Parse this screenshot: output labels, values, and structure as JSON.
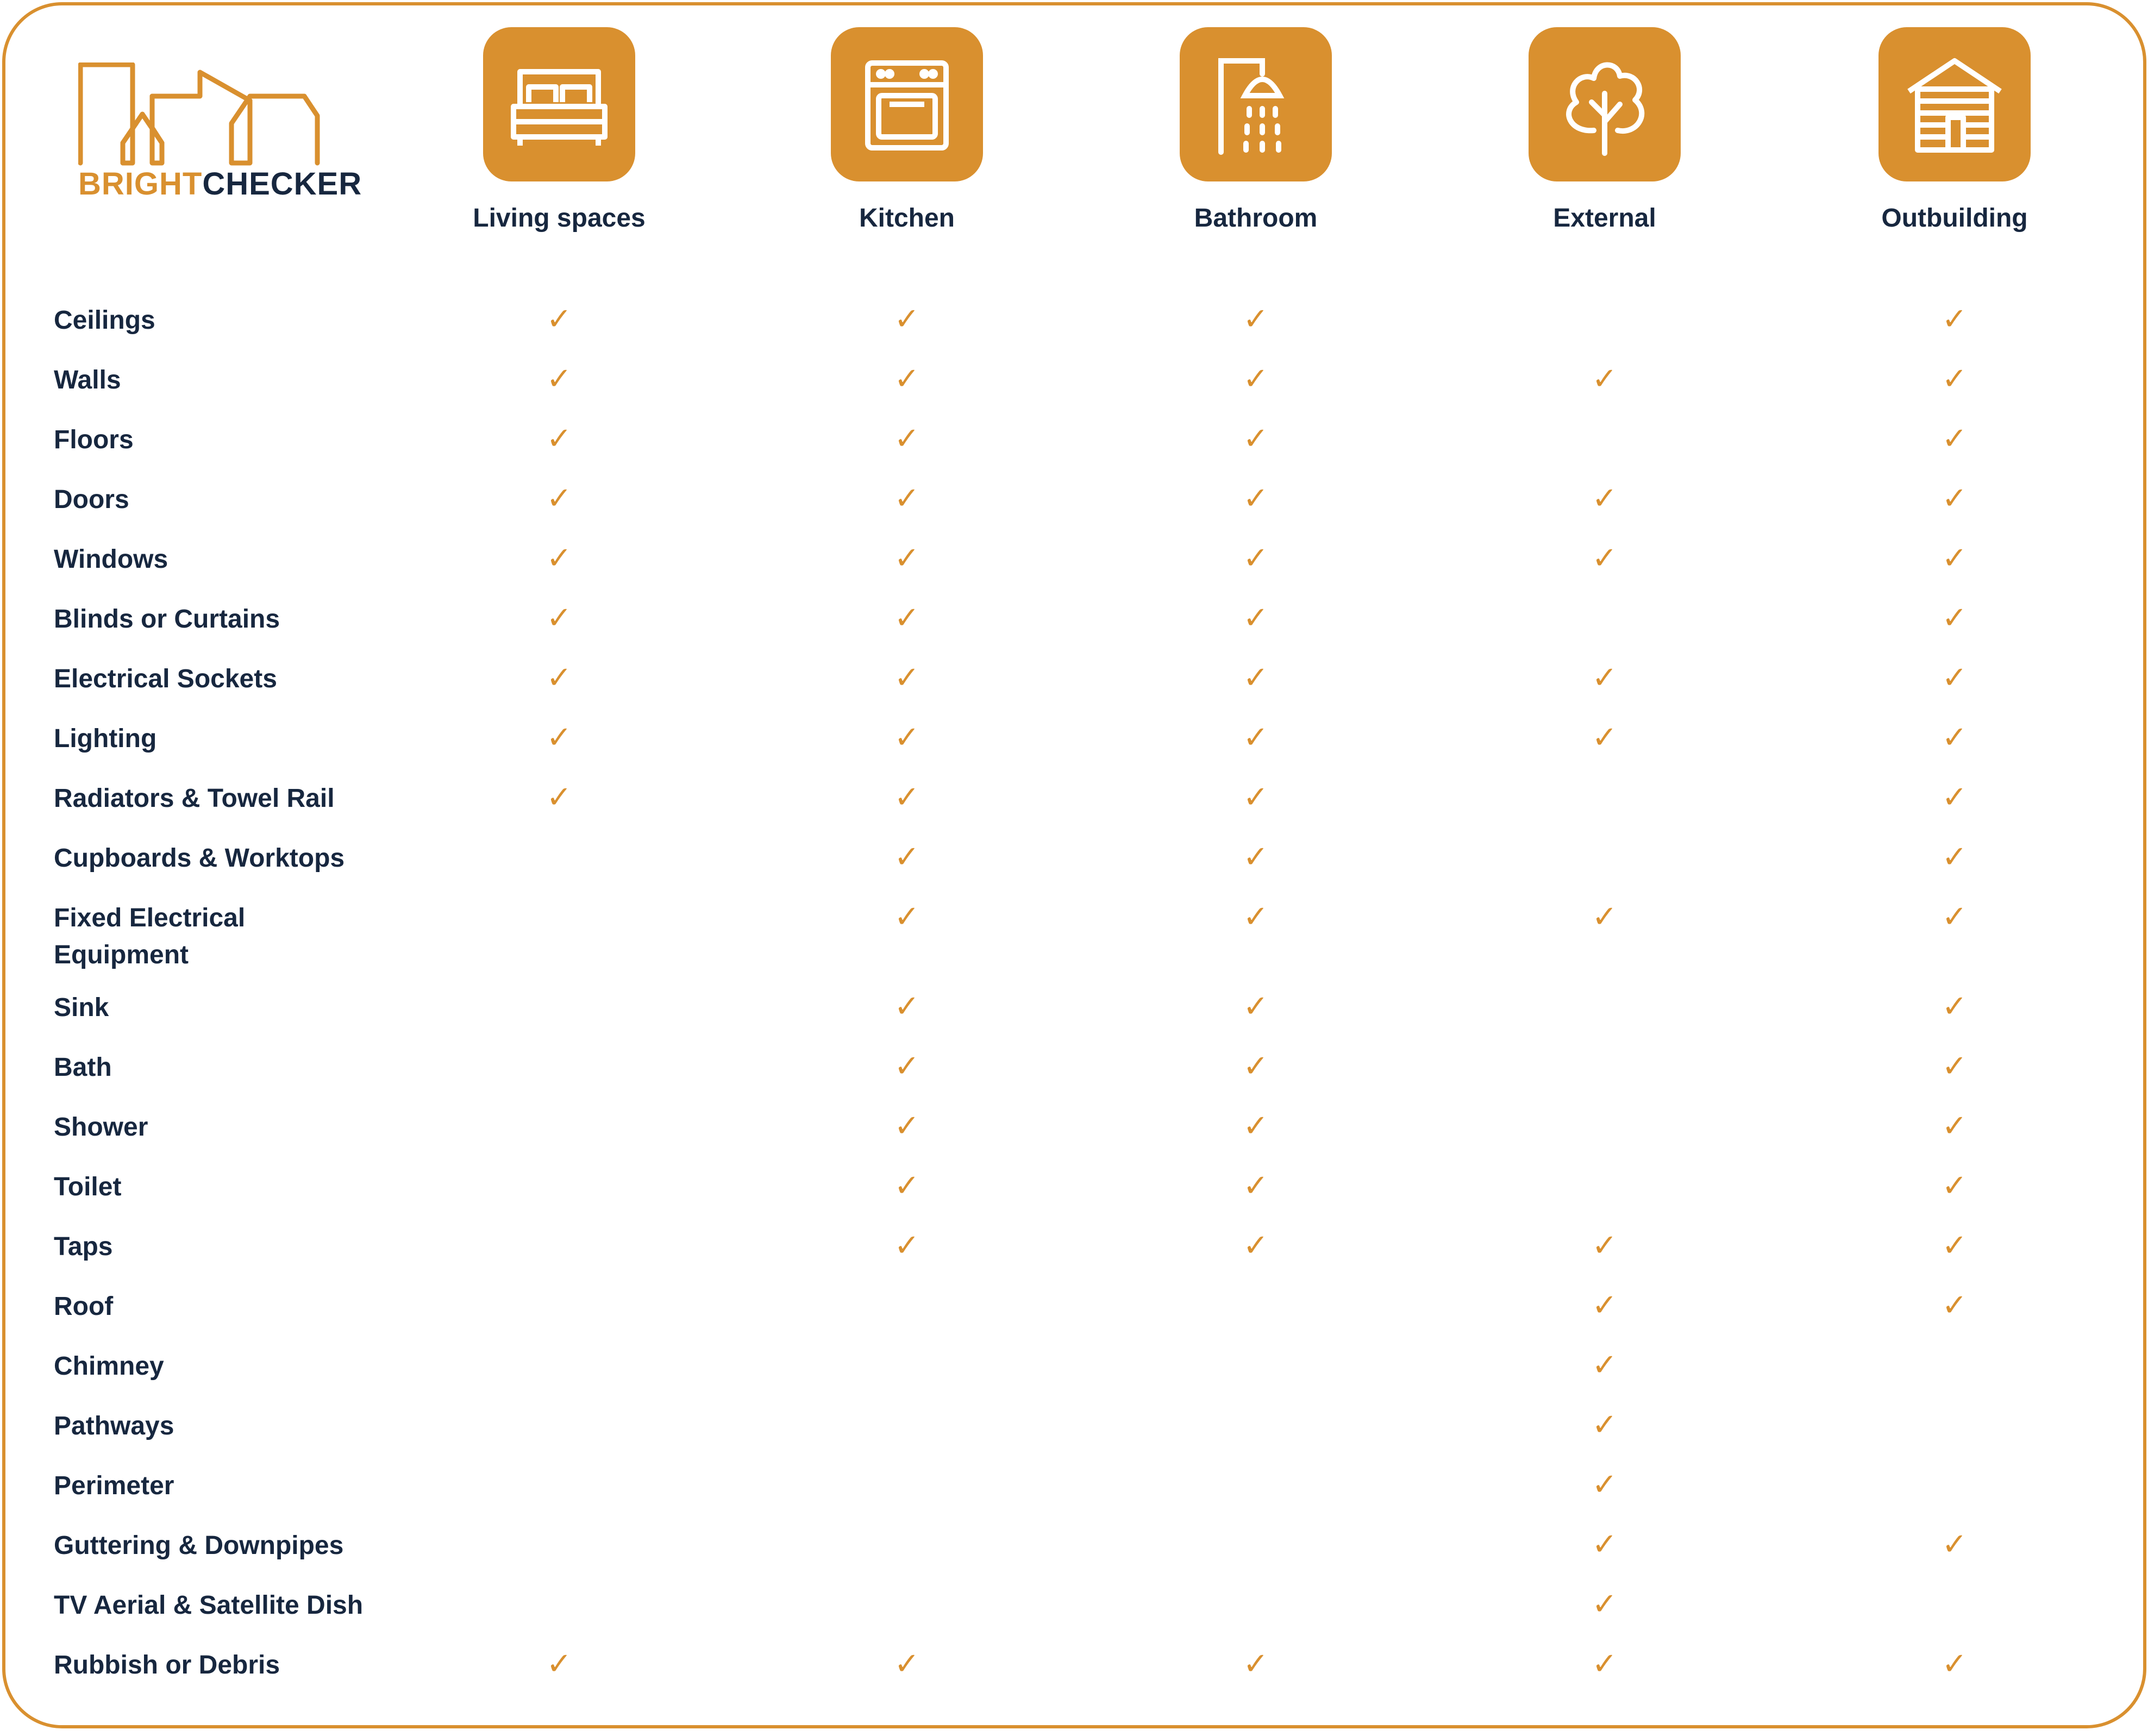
{
  "brand": {
    "part1": "BRIGHT",
    "part2": "CHECKER",
    "logo_icon": "city-skyline-icon",
    "accent_color": "#D9902F",
    "text_color": "#17273F"
  },
  "columns": [
    {
      "label": "Living spaces",
      "icon": "bed-icon"
    },
    {
      "label": "Kitchen",
      "icon": "oven-icon"
    },
    {
      "label": "Bathroom",
      "icon": "shower-icon"
    },
    {
      "label": "External",
      "icon": "tree-icon"
    },
    {
      "label": "Outbuilding",
      "icon": "shed-icon"
    }
  ],
  "check_glyph": "✓",
  "rows": [
    {
      "label": "Ceilings",
      "checks": [
        true,
        true,
        true,
        false,
        true
      ]
    },
    {
      "label": "Walls",
      "checks": [
        true,
        true,
        true,
        true,
        true
      ]
    },
    {
      "label": "Floors",
      "checks": [
        true,
        true,
        true,
        false,
        true
      ]
    },
    {
      "label": "Doors",
      "checks": [
        true,
        true,
        true,
        true,
        true
      ]
    },
    {
      "label": "Windows",
      "checks": [
        true,
        true,
        true,
        true,
        true
      ]
    },
    {
      "label": "Blinds or Curtains",
      "checks": [
        true,
        true,
        true,
        false,
        true
      ]
    },
    {
      "label": "Electrical Sockets",
      "checks": [
        true,
        true,
        true,
        true,
        true
      ]
    },
    {
      "label": "Lighting",
      "checks": [
        true,
        true,
        true,
        true,
        true
      ]
    },
    {
      "label": "Radiators & Towel Rail",
      "checks": [
        true,
        true,
        true,
        false,
        true
      ]
    },
    {
      "label": "Cupboards & Worktops",
      "checks": [
        false,
        true,
        true,
        false,
        true
      ]
    },
    {
      "label": "Fixed Electrical Equipment",
      "checks": [
        false,
        true,
        true,
        true,
        true
      ]
    },
    {
      "label": "Sink",
      "checks": [
        false,
        true,
        true,
        false,
        true
      ]
    },
    {
      "label": "Bath",
      "checks": [
        false,
        true,
        true,
        false,
        true
      ]
    },
    {
      "label": "Shower",
      "checks": [
        false,
        true,
        true,
        false,
        true
      ]
    },
    {
      "label": "Toilet",
      "checks": [
        false,
        true,
        true,
        false,
        true
      ]
    },
    {
      "label": "Taps",
      "checks": [
        false,
        true,
        true,
        true,
        true
      ]
    },
    {
      "label": "Roof",
      "checks": [
        false,
        false,
        false,
        true,
        true
      ]
    },
    {
      "label": "Chimney",
      "checks": [
        false,
        false,
        false,
        true,
        false
      ]
    },
    {
      "label": "Pathways",
      "checks": [
        false,
        false,
        false,
        true,
        false
      ]
    },
    {
      "label": "Perimeter",
      "checks": [
        false,
        false,
        false,
        true,
        false
      ]
    },
    {
      "label": "Guttering & Downpipes",
      "checks": [
        false,
        false,
        false,
        true,
        true
      ]
    },
    {
      "label": "TV Aerial & Satellite Dish",
      "checks": [
        false,
        false,
        false,
        true,
        false
      ]
    },
    {
      "label": "Rubbish or Debris",
      "checks": [
        true,
        true,
        true,
        true,
        true
      ]
    }
  ]
}
